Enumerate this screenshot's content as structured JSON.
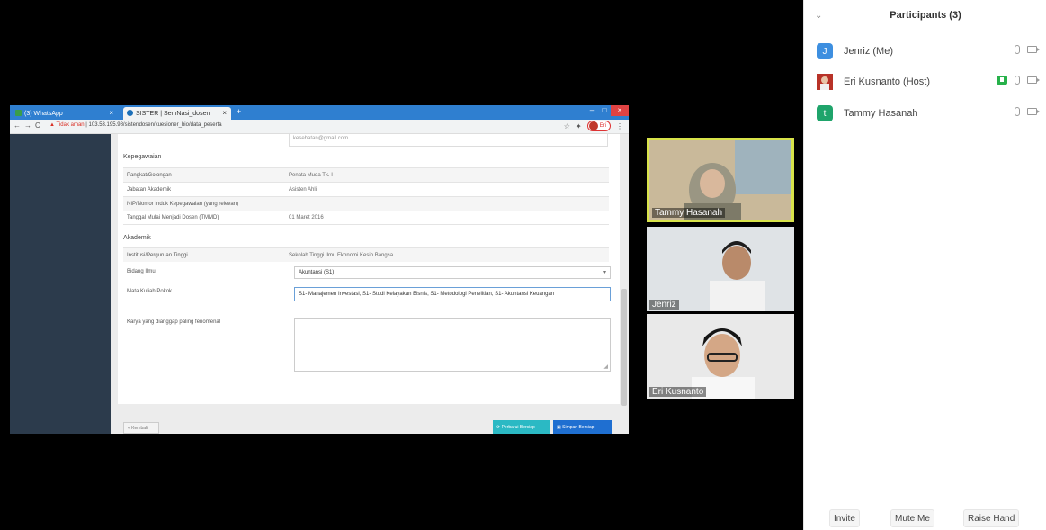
{
  "browser": {
    "tabs": [
      {
        "label": "(3) WhatsApp"
      },
      {
        "label": "SISTER | SemNasi_dosen"
      }
    ],
    "new_tab": "+",
    "url_warning": "Tidak aman",
    "url": "103.53.195.98/sister/dosen/kuesioner_bio/data_peserta",
    "profile_label": "Eri",
    "top_field_value": "kesehatan@gmail.com"
  },
  "form": {
    "section_kepegawaian": "Kepegawaian",
    "kepegawaian_rows": [
      {
        "label": "Pangkat/Golongan",
        "value": "Penata Muda Tk. I"
      },
      {
        "label": "Jabatan Akademik",
        "value": "Asisten Ahli"
      },
      {
        "label": "NIP/Nomor Induk Kepegawaian (yang relevan)",
        "value": ""
      },
      {
        "label": "Tanggal Mulai Menjadi Dosen (TMMD)",
        "value": "01 Maret 2016"
      }
    ],
    "section_akademik": "Akademik",
    "institusi_label": "Institusi/Perguruan Tinggi",
    "institusi_value": "Sekolah Tinggi Ilmu Ekonomi Kesih Bangsa",
    "bidang_label": "Bidang Ilmu",
    "bidang_value": "Akuntansi (S1)",
    "matkul_label": "Mata Kuliah Pokok",
    "matkul_value": "S1- Manajemen Investasi, S1- Studi Kelayakan Bisnis, S1- Metodologi Penelitian, S1- Akuntansi Keuangan",
    "karya_label": "Karya yang dianggap paling fenomenal",
    "back_button": "« Kembali",
    "btn_secondary": "Perbarui Bersiap",
    "btn_primary": "Simpan Bersiap"
  },
  "videos": [
    {
      "name": "Tammy Hasanah"
    },
    {
      "name": "Jenriz"
    },
    {
      "name": "Eri Kusnanto"
    }
  ],
  "panel": {
    "title": "Participants (3)",
    "participants": [
      {
        "initial": "J",
        "name": "Jenriz (Me)",
        "color": "#3d8fe0"
      },
      {
        "initial": "",
        "name": "Eri Kusnanto (Host)",
        "color": "#c0392b"
      },
      {
        "initial": "t",
        "name": "Tammy Hasanah",
        "color": "#1fa46b"
      }
    ],
    "buttons": {
      "invite": "Invite",
      "mute": "Mute Me",
      "raise": "Raise Hand"
    }
  }
}
